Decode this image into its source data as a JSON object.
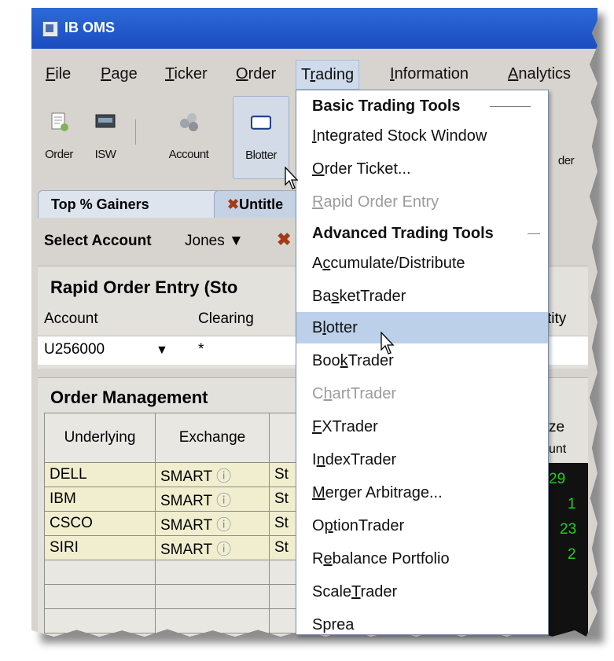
{
  "window": {
    "title": "IB OMS"
  },
  "menubar": {
    "items": [
      {
        "label": "File",
        "ul": "F",
        "rest": "ile"
      },
      {
        "label": "Page",
        "ul": "P",
        "rest": "age"
      },
      {
        "label": "Ticker",
        "ul": "T",
        "rest": "icker"
      },
      {
        "label": "Order",
        "ul": "O",
        "rest": "rder"
      },
      {
        "label": "Trading",
        "pre": "T",
        "ul": "r",
        "rest": "ading"
      },
      {
        "label": "Information",
        "ul": "I",
        "rest": "nformation"
      },
      {
        "label": "Analytics",
        "ul": "A",
        "rest": "nalytics"
      }
    ]
  },
  "toolbar": {
    "order": "Order",
    "isw": "ISW",
    "account": "Account",
    "blotter": "Blotter",
    "trader_partial": "der"
  },
  "tabs": {
    "top_gainers": "Top % Gainers",
    "untitled": "Untitle"
  },
  "account_bar": {
    "label": "Select Account",
    "value": "Jones"
  },
  "rapid_order_entry": {
    "title": "Rapid Order Entry (Sto",
    "col_account": "Account",
    "col_clearing": "Clearing",
    "col_quantity_partial": "tity",
    "account_value": "U256000",
    "clearing_value": "*"
  },
  "order_management": {
    "title": "Order Management",
    "headers": [
      "Underlying",
      "Exchange"
    ],
    "size_header_top": "ze",
    "size_header_bottom": "unt",
    "rows": [
      {
        "underlying": "DELL",
        "exchange": "SMART",
        "type": "St",
        "size": "29"
      },
      {
        "underlying": "IBM",
        "exchange": "SMART",
        "type": "St",
        "size": "1"
      },
      {
        "underlying": "CSCO",
        "exchange": "SMART",
        "type": "St",
        "size": "23"
      },
      {
        "underlying": "SIRI",
        "exchange": "SMART",
        "type": "St",
        "size": "2"
      }
    ]
  },
  "trading_menu": {
    "basic_header": "Basic Trading Tools",
    "advanced_header": "Advanced Trading Tools",
    "items": [
      {
        "label": "Integrated Stock Window",
        "pre": "",
        "ul": "I",
        "rest": "ntegrated Stock Window",
        "disabled": false
      },
      {
        "label": "Order Ticket...",
        "pre": "",
        "ul": "O",
        "rest": "rder Ticket...",
        "disabled": false
      },
      {
        "label": "Rapid Order Entry",
        "pre": "",
        "ul": "R",
        "rest": "apid Order Entry",
        "disabled": true
      },
      {
        "label": "Accumulate/Distribute",
        "pre": "A",
        "ul": "c",
        "rest": "cumulate/Distribute",
        "disabled": false
      },
      {
        "label": "BasketTrader",
        "pre": "Ba",
        "ul": "s",
        "rest": "ketTrader",
        "disabled": false
      },
      {
        "label": "Blotter",
        "pre": "B",
        "ul": "l",
        "rest": "otter",
        "disabled": false,
        "highlighted": true
      },
      {
        "label": "BookTrader",
        "pre": "Boo",
        "ul": "k",
        "rest": "Trader",
        "disabled": false
      },
      {
        "label": "ChartTrader",
        "pre": "C",
        "ul": "h",
        "rest": "artTrader",
        "disabled": true
      },
      {
        "label": "FXTrader",
        "pre": "",
        "ul": "F",
        "rest": "XTrader",
        "disabled": false
      },
      {
        "label": "IndexTrader",
        "pre": "I",
        "ul": "n",
        "rest": "dexTrader",
        "disabled": false
      },
      {
        "label": "Merger Arbitrage...",
        "pre": "",
        "ul": "M",
        "rest": "erger Arbitrage...",
        "disabled": false
      },
      {
        "label": "OptionTrader",
        "pre": "O",
        "ul": "p",
        "rest": "tionTrader",
        "disabled": false
      },
      {
        "label": "Rebalance Portfolio",
        "pre": "R",
        "ul": "e",
        "rest": "balance Portfolio",
        "disabled": false
      },
      {
        "label": "ScaleTrader",
        "pre": "Scale",
        "ul": "T",
        "rest": "rader",
        "disabled": false
      },
      {
        "label": "SpreadTrader",
        "pre": "Sprea",
        "ul": "",
        "rest": "",
        "disabled": false
      }
    ]
  },
  "colors": {
    "titlebar": "#1f55c8",
    "menu_highlight": "#bcd0ea",
    "disabled_text": "#9c9c9c",
    "size_text": "#20d020"
  }
}
